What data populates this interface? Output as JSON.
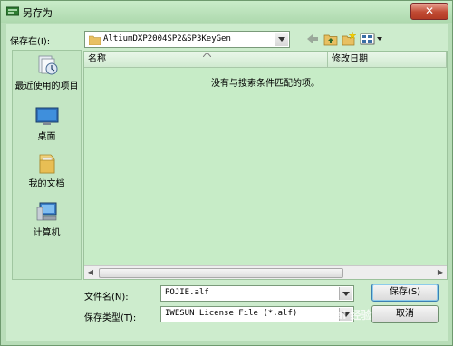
{
  "window": {
    "title": "另存为",
    "close_label": "✕"
  },
  "toolbar": {
    "save_in_label": "保存在(I):",
    "current_folder": "AltiumDXP2004SP2&SP3KeyGen"
  },
  "places": [
    {
      "label": "最近使用的项目",
      "icon": "recent-items-icon"
    },
    {
      "label": "桌面",
      "icon": "desktop-icon"
    },
    {
      "label": "我的文档",
      "icon": "documents-icon"
    },
    {
      "label": "计算机",
      "icon": "computer-icon"
    }
  ],
  "file_list": {
    "columns": [
      "名称",
      "修改日期"
    ],
    "empty_message": "没有与搜索条件匹配的项。"
  },
  "form": {
    "filename_label": "文件名(N):",
    "filename_value": "POJIE.alf",
    "filetype_label": "保存类型(T):",
    "filetype_value": "IWESUN License File (*.alf)"
  },
  "buttons": {
    "save": "保存(S)",
    "cancel": "取消"
  },
  "watermark": "Bai 经验"
}
